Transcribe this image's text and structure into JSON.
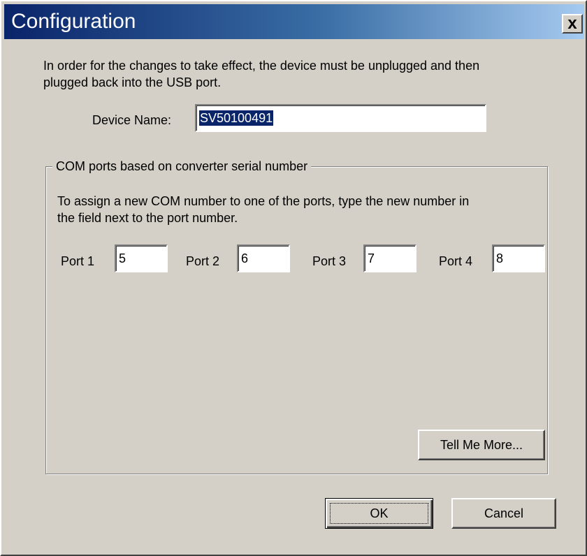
{
  "window": {
    "title": "Configuration",
    "close_glyph": "x"
  },
  "intro_text": "In order for the changes to take effect, the device must be unplugged and then\nplugged back into the USB port.",
  "device": {
    "label": "Device Name:",
    "value": "SV50100491"
  },
  "com_group": {
    "legend": "COM ports based on converter serial number",
    "instruction": "To assign a new COM number to one of the ports, type the new number in\nthe field next to the port number.",
    "ports": [
      {
        "label": "Port 1",
        "value": "5"
      },
      {
        "label": "Port 2",
        "value": "6"
      },
      {
        "label": "Port 3",
        "value": "7"
      },
      {
        "label": "Port 4",
        "value": "8"
      }
    ],
    "tell_me_more_label": "Tell Me More..."
  },
  "buttons": {
    "ok_label": "OK",
    "cancel_label": "Cancel"
  },
  "colors": {
    "dialog_face": "#d4d0c8",
    "title_start": "#0a246a",
    "title_end": "#a6caf0",
    "selection": "#0a246a"
  }
}
